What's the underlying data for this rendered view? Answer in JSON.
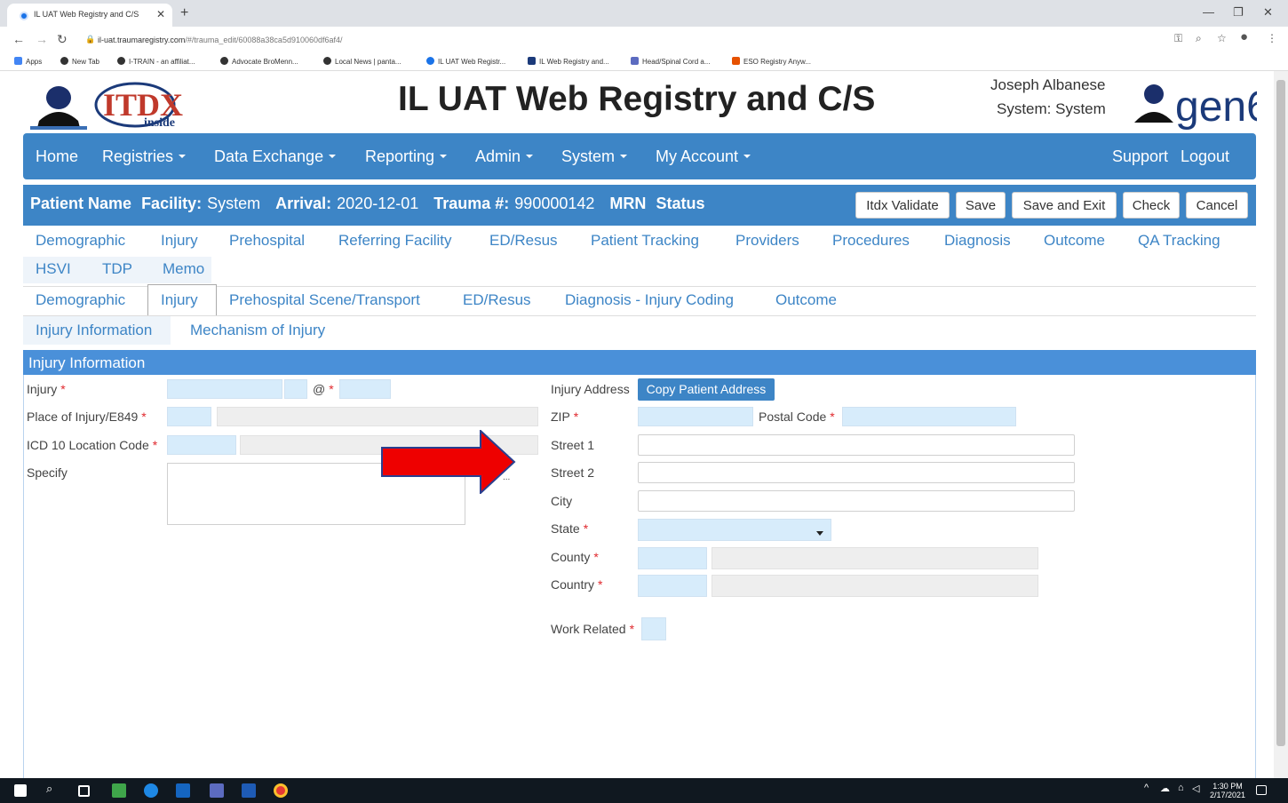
{
  "browser": {
    "tab_title": "IL UAT Web Registry and C/S",
    "url_host": "il-uat.traumaregistry.com",
    "url_path": "/#/trauma_edit/60088a38ca5d910060df6af4/",
    "bookmarks": [
      "Apps",
      "New Tab",
      "I-TRAIN - an affiliat...",
      "Advocate BroMenn...",
      "Local News | panta...",
      "IL UAT Web Registr...",
      "IL Web Registry and...",
      "Head/Spinal Cord a...",
      "ESO Registry Anyw..."
    ]
  },
  "header": {
    "title": "IL UAT Web Registry and C/S",
    "user_name": "Joseph Albanese",
    "user_system": "System: System",
    "left_logo_text": "ITDX",
    "left_logo_sub": "inside",
    "right_logo_text": "gen6"
  },
  "nav": {
    "home": "Home",
    "registries": "Registries",
    "data_exchange": "Data Exchange",
    "reporting": "Reporting",
    "admin": "Admin",
    "system": "System",
    "my_account": "My Account",
    "support": "Support",
    "logout": "Logout"
  },
  "patient": {
    "name_label": "Patient Name",
    "facility_label": "Facility:",
    "facility_value": "System",
    "arrival_label": "Arrival:",
    "arrival_value": "2020-12-01",
    "trauma_label": "Trauma #:",
    "trauma_value": "990000142",
    "mrn_label": "MRN",
    "status_label": "Status",
    "buttons": {
      "itdx_validate": "Itdx Validate",
      "save": "Save",
      "save_exit": "Save and Exit",
      "check": "Check",
      "cancel": "Cancel"
    }
  },
  "tabs_main": [
    "Demographic",
    "Injury",
    "Prehospital",
    "Referring Facility",
    "ED/Resus",
    "Patient Tracking",
    "Providers",
    "Procedures",
    "Diagnosis",
    "Outcome",
    "QA Tracking",
    "HSVI",
    "TDP",
    "Memo"
  ],
  "tabs_sub": [
    "Demographic",
    "Injury",
    "Prehospital Scene/Transport",
    "ED/Resus",
    "Diagnosis - Injury Coding",
    "Outcome"
  ],
  "tabs_injury": [
    "Injury Information",
    "Mechanism of Injury"
  ],
  "section": {
    "title": "Injury Information",
    "injury_label": "Injury",
    "at_label": "@",
    "place_label": "Place of Injury/E849",
    "icd_label": "ICD 10 Location Code",
    "specify_label": "Specify",
    "injury_address_label": "Injury Address",
    "copy_button": "Copy Patient Address",
    "zip_label": "ZIP",
    "postal_label": "Postal Code",
    "street1_label": "Street 1",
    "street2_label": "Street 2",
    "city_label": "City",
    "state_label": "State",
    "county_label": "County",
    "country_label": "Country",
    "work_related_label": "Work Related",
    "specify_ellipsis": "..."
  },
  "taskbar": {
    "time": "1:30 PM",
    "date": "2/17/2021"
  },
  "colors": {
    "nav_blue": "#3d85c6",
    "section_blue": "#4a90d9",
    "field_blue": "#d7ecfb",
    "required_red": "#e0282d",
    "arrow_red": "#ee0000"
  }
}
